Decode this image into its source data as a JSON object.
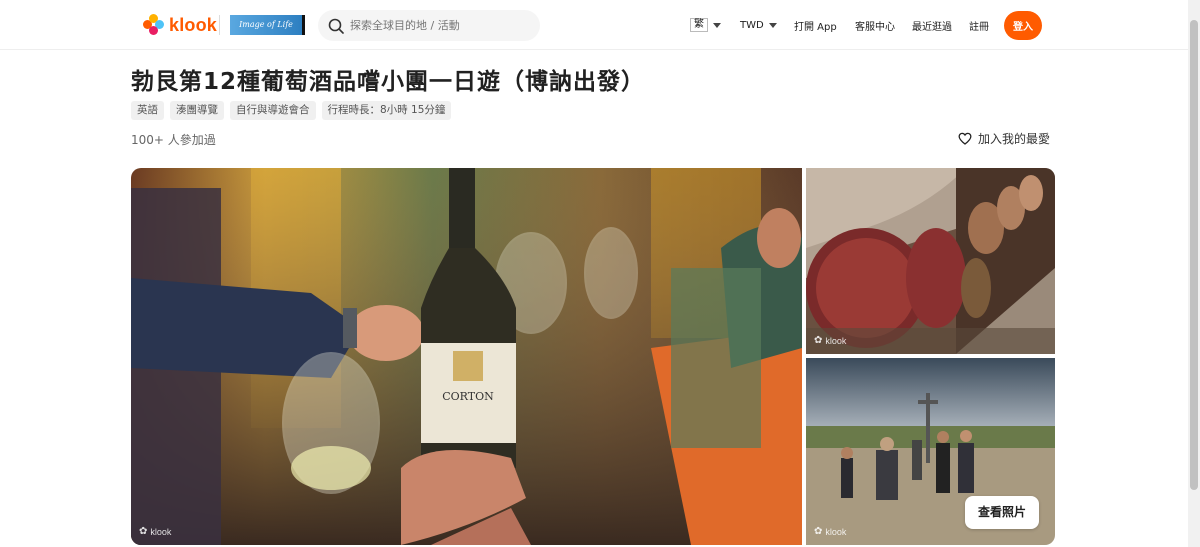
{
  "header": {
    "logo_text": "klook",
    "partner_badge_text": "Image of Life",
    "search_placeholder": "探索全球目的地 / 活動",
    "language": "繁",
    "currency": "TWD",
    "open_app": "打開 App",
    "customer_service": "客服中心",
    "recently_viewed": "最近逛過",
    "register": "註冊",
    "login": "登入",
    "brand_color": "#ff5b00"
  },
  "activity": {
    "title": "勃艮第12種葡萄酒品嚐小團一日遊（博訥出發）",
    "tags": [
      "英語",
      "湊團導覽",
      "自行與導遊會合",
      "行程時長：8小時 15分鐘"
    ],
    "participants": "100+ 人參加過",
    "wishlist_label": "加入我的最愛"
  },
  "gallery": {
    "bottle_label_text": "CORTON",
    "watermark": "klook",
    "view_photos_button": "查看照片"
  }
}
